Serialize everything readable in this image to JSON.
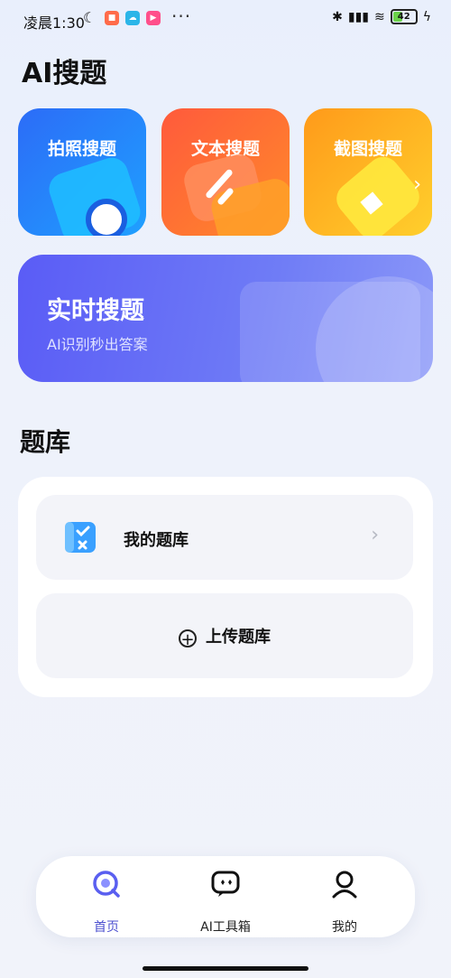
{
  "status_bar": {
    "time": "凌晨1:30",
    "battery": "42"
  },
  "page_title": "AI搜题",
  "quick_cards": [
    {
      "label": "拍照搜题"
    },
    {
      "label": "文本搜题"
    },
    {
      "label": "截图搜题"
    }
  ],
  "realtime": {
    "title": "实时搜题",
    "subtitle": "AI识别秒出答案"
  },
  "bank": {
    "section_title": "题库",
    "my_bank": "我的题库",
    "upload": "上传题库"
  },
  "tabbar": {
    "items": [
      {
        "label": "首页"
      },
      {
        "label": "AI工具箱"
      },
      {
        "label": "我的"
      }
    ]
  },
  "colors": {
    "accent": "#4b4fcf",
    "card1": "#2c6cf7",
    "card2": "#ff5a3c",
    "card3": "#ffb21e",
    "realtime": "#5a5cf6"
  }
}
